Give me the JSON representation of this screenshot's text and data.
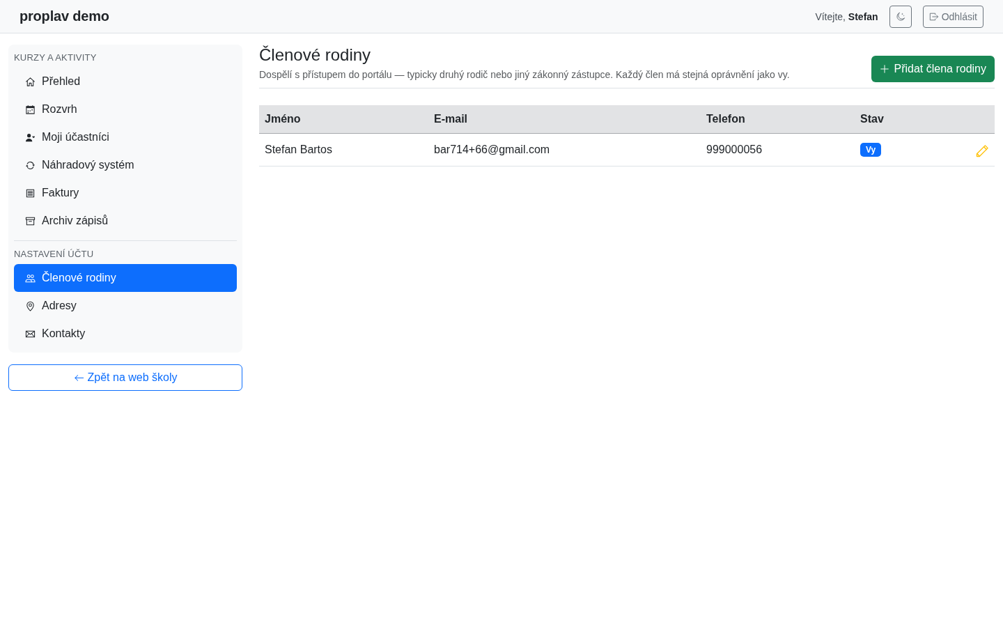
{
  "header": {
    "brand": "proplav demo",
    "greeting": "Vítejte, **Stefan**",
    "logout_button": "Odhlásit"
  },
  "sidebar": {
    "sections": [
      {
        "heading": "KURZY A AKTIVITY",
        "items": [
          {
            "label": "Přehled",
            "selected": false
          },
          {
            "label": "Rozvrh",
            "selected": false
          },
          {
            "label": "Moji účastníci",
            "selected": false
          },
          {
            "label": "Náhradový systém",
            "selected": false
          },
          {
            "label": "Faktury",
            "selected": false
          },
          {
            "label": "Archiv zápisů",
            "selected": false
          }
        ]
      },
      {
        "heading": "NASTAVENÍ ÚČTU",
        "items": [
          {
            "label": "Členové rodiny",
            "selected": true
          },
          {
            "label": "Adresy",
            "selected": false
          },
          {
            "label": "Kontakty",
            "selected": false
          }
        ]
      }
    ],
    "back_button": "Zpět na web školy"
  },
  "main": {
    "title": "Členové rodiny",
    "description": "Dospělí s přístupem do portálu — typicky druhý rodič nebo jiný zákonný zástupce. Každý člen má stejná oprávnění jako vy.",
    "add_button": "Přidat člena rodiny",
    "table": {
      "columns": [
        "Jméno",
        "E-mail",
        "Telefon",
        "Stav"
      ],
      "rows": [
        {
          "name": "Stefan Bartos",
          "email": "bar714+66@gmail.com",
          "phone": "999000056",
          "status_badge": "Vy"
        }
      ]
    }
  }
}
